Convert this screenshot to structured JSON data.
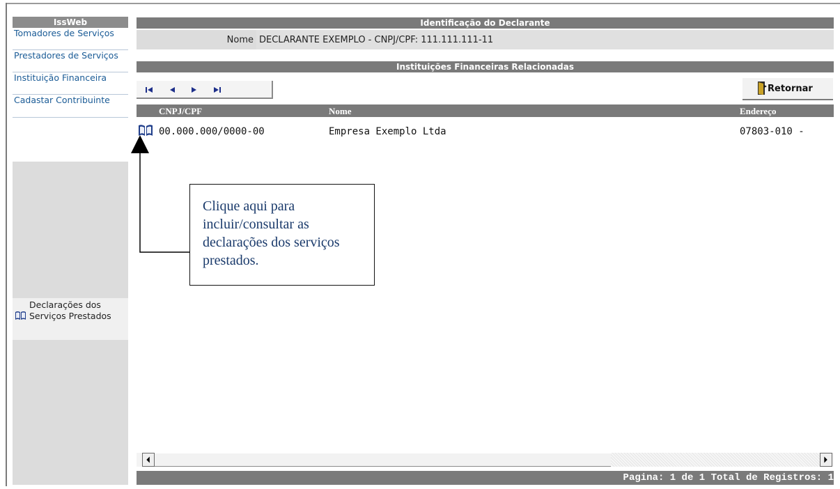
{
  "sidebar": {
    "title": "IssWeb",
    "items": [
      {
        "label": "Tomadores de Serviços"
      },
      {
        "label": "Prestadores de Serviços"
      },
      {
        "label": "Instituição Financeira"
      },
      {
        "label": "Cadastar Contribuinte"
      }
    ],
    "declaracoes_label": "Declarações dos Serviços Prestados"
  },
  "header": {
    "section_title": "Identificação do Declarante",
    "nome_label": "Nome",
    "nome_value": "DECLARANTE EXEMPLO - CNPJ/CPF: 111.111.111-11"
  },
  "instituicoes": {
    "title": "Instituições Financeiras Relacionadas",
    "retornar_label": "Retornar",
    "columns": [
      "CNPJ/CPF",
      "Nome",
      "Endereço"
    ],
    "rows": [
      {
        "cnpj": "00.000.000/0000-00",
        "nome": "Empresa Exemplo Ltda",
        "endereco": "07803-010 -"
      }
    ]
  },
  "footer": {
    "text": "Pagina: 1 de 1 Total de Registros: 1"
  },
  "callout": {
    "text": "Clique aqui para incluir/consultar as declarações dos serviços prestados."
  },
  "icons": {
    "first": "first-page-icon",
    "prev": "prev-page-icon",
    "next": "next-page-icon",
    "last": "last-page-icon",
    "book": "book-icon",
    "door": "exit-door-icon"
  },
  "colors": {
    "header_bar": "#7a7a7a",
    "menu_text": "#1a5b96",
    "sidebar_bg": "#dcdcdc",
    "book_icon": "#1f3d8a"
  }
}
